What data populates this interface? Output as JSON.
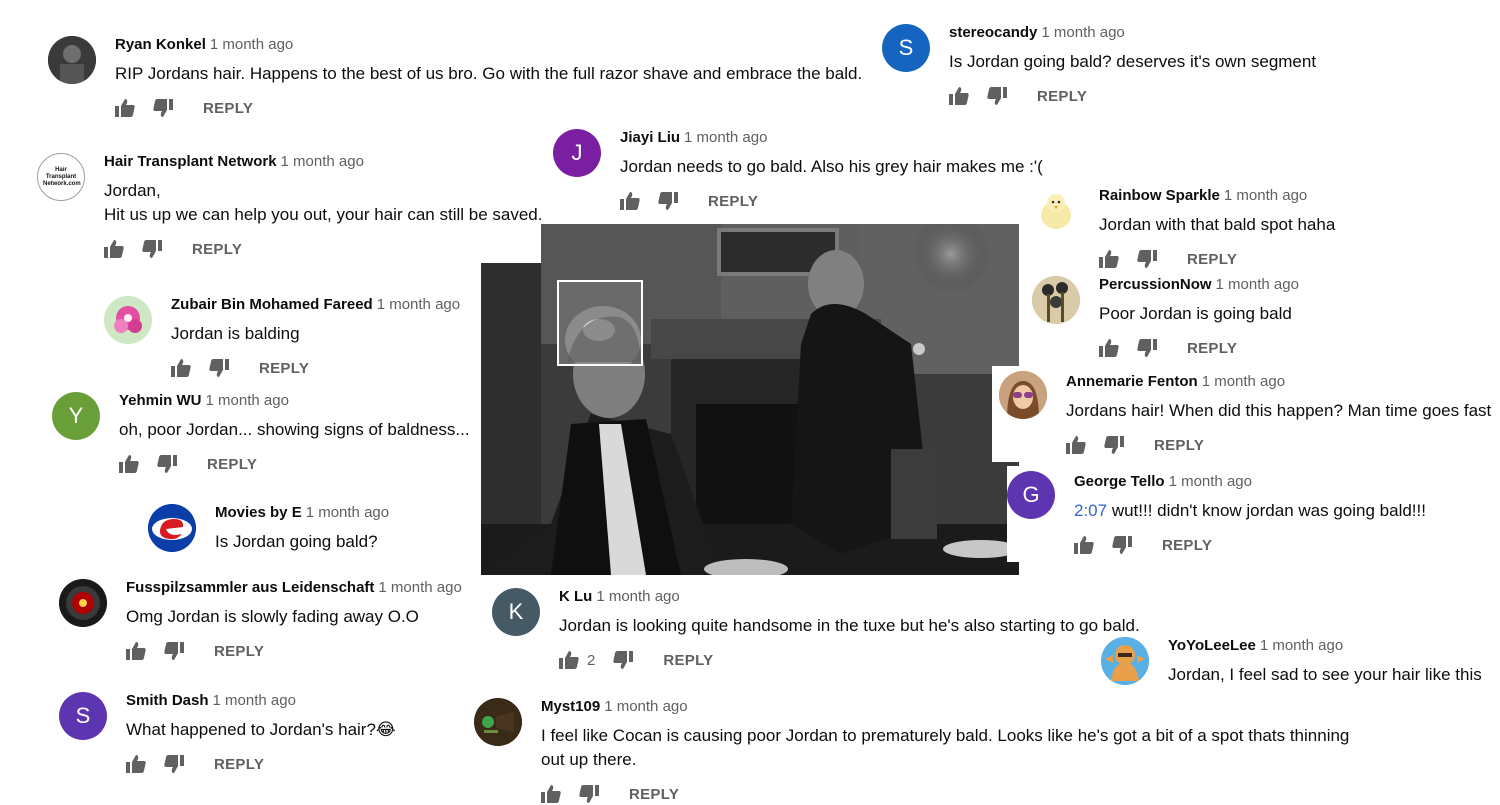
{
  "reply_label": "REPLY",
  "colors": {
    "author": "#0d0d0d",
    "time": "#606060",
    "timestamp_link": "#3366cc",
    "avatar_stereocandy": "#1565c0",
    "avatar_jiayi": "#7b1fa2",
    "avatar_yehmin": "#689f38",
    "avatar_george": "#5e35b1",
    "avatar_klu": "#455a64",
    "avatar_smith": "#5e35b1"
  },
  "comments": [
    {
      "author": "Ryan Konkel",
      "time": "1 month ago",
      "lines": [
        "RIP Jordans hair.  Happens to the best of us bro.  Go with the full razor shave and embrace the bald."
      ],
      "avatar": "photo-avatar"
    },
    {
      "author": "stereocandy",
      "time": "1 month ago",
      "lines": [
        "Is Jordan going bald? deserves it's own segment"
      ],
      "avatar_letter": "S"
    },
    {
      "author": "Jiayi Liu",
      "time": "1 month ago",
      "lines": [
        "Jordan needs to go bald. Also his grey hair makes me :'("
      ],
      "avatar_letter": "J"
    },
    {
      "author": "Hair Transplant Network",
      "time": "1 month ago",
      "lines": [
        "Jordan,",
        "Hit us up we can help you out, your hair can still be saved."
      ],
      "avatar_text": "Hair Transplant Network.com"
    },
    {
      "author": "Rainbow Sparkle",
      "time": "1 month ago",
      "lines": [
        "Jordan with that bald spot haha"
      ],
      "avatar": "chick-avatar"
    },
    {
      "author": "Zubair Bin Mohamed Fareed",
      "time": "1 month ago",
      "lines": [
        "Jordan is balding"
      ],
      "avatar": "flower-avatar"
    },
    {
      "author": "PercussionNow",
      "time": "1 month ago",
      "lines": [
        "Poor Jordan is going bald"
      ],
      "avatar": "drumsticks-avatar"
    },
    {
      "author": "Yehmin WU",
      "time": "1 month ago",
      "lines": [
        "oh, poor Jordan... showing signs of baldness..."
      ],
      "avatar_letter": "Y"
    },
    {
      "author": "Annemarie Fenton",
      "time": "1 month ago",
      "lines": [
        "Jordans hair! When did this happen? Man time goes fast"
      ],
      "avatar": "photo-avatar"
    },
    {
      "author": "George Tello",
      "time": "1 month ago",
      "timestamp": "2:07",
      "lines": [
        " wut!!! didn't know jordan was going bald!!!"
      ],
      "avatar_letter": "G"
    },
    {
      "author": "Movies by E",
      "time": "1 month ago",
      "lines": [
        "Is Jordan going bald?"
      ],
      "avatar": "logo-e-avatar"
    },
    {
      "author": "Fusspilzsammler aus Leidenschaft",
      "time": "1 month ago",
      "lines": [
        "Omg Jordan is slowly fading away O.O"
      ],
      "avatar": "red-eye-avatar"
    },
    {
      "author": "K Lu",
      "time": "1 month ago",
      "lines": [
        "Jordan is looking quite handsome in the tuxe but he's also starting to go bald."
      ],
      "avatar_letter": "K",
      "likes": "2"
    },
    {
      "author": "YoYoLeeLee",
      "time": "1 month ago",
      "lines": [
        "Jordan, I feel sad to see your hair like this"
      ],
      "avatar": "cartoon-avatar"
    },
    {
      "author": "Smith Dash",
      "time": "1 month ago",
      "lines": [
        "What happened to Jordan's hair?"
      ],
      "emoji": "😂",
      "avatar_letter": "S"
    },
    {
      "author": "Myst109",
      "time": "1 month ago",
      "lines": [
        "I feel like Cocan is causing poor Jordan to prematurely bald. Looks like he's got a bit of a spot thats thinning",
        "out up there."
      ],
      "avatar": "game-avatar"
    }
  ]
}
